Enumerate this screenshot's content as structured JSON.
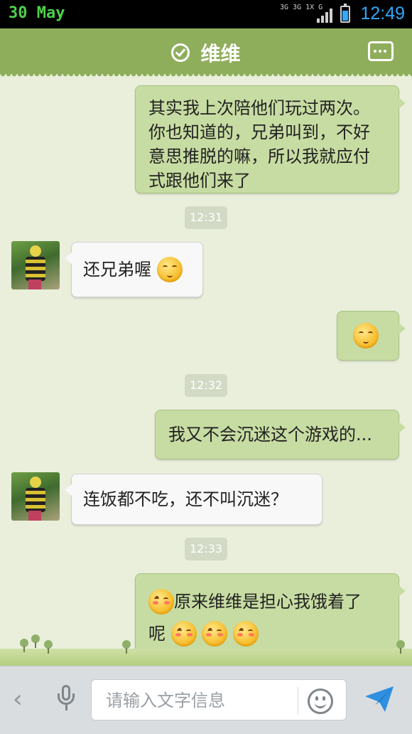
{
  "status_bar": {
    "date": "30 May",
    "network_top": "3G 3G 1X G",
    "time": "12:49"
  },
  "header": {
    "title": "维维"
  },
  "messages": [
    {
      "type": "out",
      "text": "其实我上次陪他们玩过两次。你也知道的，兄弟叫到，不好意思推脱的嘛，所以我就应付式跟他们来了"
    },
    {
      "type": "time",
      "text": "12:31"
    },
    {
      "type": "in",
      "text": "还兄弟喔"
    },
    {
      "type": "out",
      "text": ""
    },
    {
      "type": "time",
      "text": "12:32"
    },
    {
      "type": "out",
      "text": "我又不会沉迷这个游戏的..."
    },
    {
      "type": "in",
      "text": "连饭都不吃，还不叫沉迷？"
    },
    {
      "type": "time",
      "text": "12:33"
    },
    {
      "type": "out",
      "text_a": "原来维维是担心我饿着了",
      "text_b": "呢"
    }
  ],
  "input": {
    "placeholder": "请输入文字信息"
  },
  "colors": {
    "header": "#8fae5c",
    "outgoing_bubble": "#c7dca2",
    "incoming_bubble": "#f8f8f8",
    "chat_background": "#e9efdb",
    "send": "#2f8fe0"
  }
}
